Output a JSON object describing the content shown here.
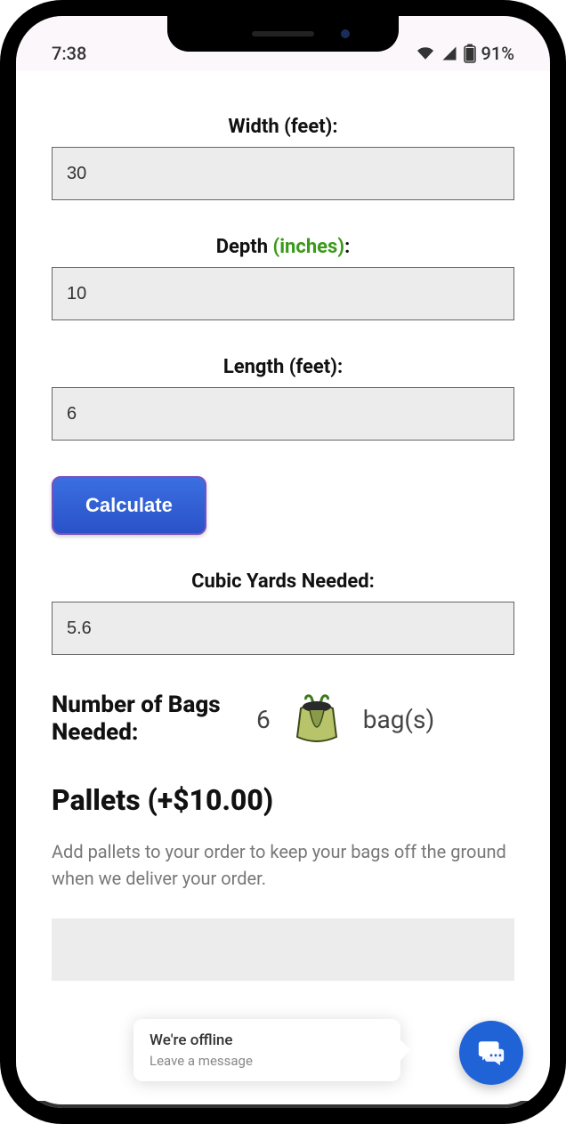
{
  "status": {
    "time": "7:38",
    "battery": "91%"
  },
  "form": {
    "width": {
      "label_main": "Width ",
      "label_unit": "(feet):",
      "value": "30"
    },
    "depth": {
      "label_main": "Depth ",
      "label_unit": "(inches)",
      "label_colon": ":",
      "value": "10"
    },
    "length": {
      "label_main": "Length ",
      "label_unit": "(feet):",
      "value": "6"
    },
    "calculate_label": "Calculate",
    "cubic": {
      "label": "Cubic Yards Needed:",
      "value": "5.6"
    }
  },
  "result": {
    "label": "Number of Bags Needed:",
    "count": "6",
    "unit": "bag(s)"
  },
  "pallets": {
    "heading": "Pallets (+$10.00)",
    "description": "Add pallets to your order to keep your bags off the ground when we deliver your order."
  },
  "chat": {
    "title": "We're offline",
    "subtitle": "Leave a message"
  }
}
